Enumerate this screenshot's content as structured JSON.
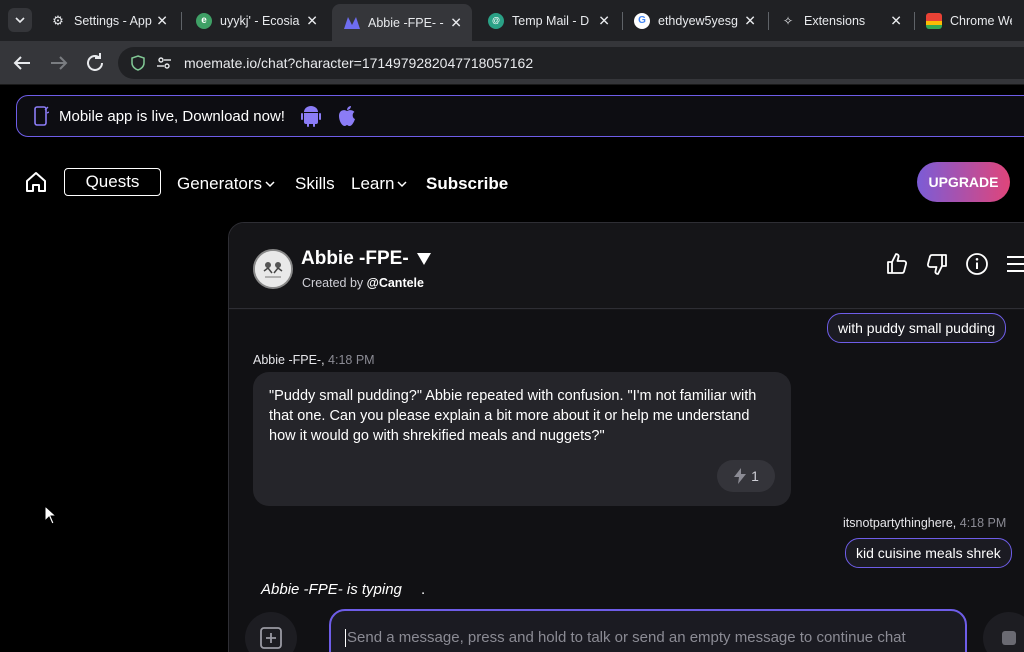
{
  "browser": {
    "tabs": [
      {
        "title": "Settings - App",
        "favicon": "gear-icon",
        "active": false
      },
      {
        "title": "uyykj' - Ecosia",
        "favicon": "ecosia-icon",
        "active": false
      },
      {
        "title": "Abbie -FPE- -",
        "favicon": "moemate-icon",
        "active": true
      },
      {
        "title": "Temp Mail - D",
        "favicon": "tempmail-icon",
        "active": false
      },
      {
        "title": "ethdyew5yesg",
        "favicon": "google-icon",
        "active": false
      },
      {
        "title": "Extensions",
        "favicon": "puzzle-icon",
        "active": false
      },
      {
        "title": "Chrome Web",
        "favicon": "chrome-webstore-icon",
        "active": false
      }
    ],
    "url": "moemate.io/chat?character=1714979282047718057162"
  },
  "banner": {
    "text": "Mobile app is live, Download now!",
    "accent": "#6e5de8"
  },
  "nav": {
    "quests": "Quests",
    "generators": "Generators",
    "skills": "Skills",
    "learn": "Learn",
    "subscribe": "Subscribe",
    "upgrade": "UPGRADE"
  },
  "chat": {
    "character_name": "Abbie -FPE-",
    "created_by_prefix": "Created by",
    "creator": "@Cantele",
    "messages": [
      {
        "role": "user",
        "text": "with puddy small pudding"
      },
      {
        "role": "bot",
        "author": "Abbie -FPE-,",
        "time": "4:18 PM",
        "text": "\"Puddy small pudding?\" Abbie repeated with confusion. \"I'm not familiar with that one. Can you please explain a bit more about it or help me understand how it would go with shrekified meals and nuggets?\"",
        "reaction_count": "1"
      },
      {
        "role": "user",
        "author": "itsnotpartythinghere,",
        "time": "4:18 PM",
        "text": "kid cuisine meals shrek"
      }
    ],
    "typing": "Abbie -FPE- is typing",
    "typing_dot": ".",
    "input_placeholder": "Send a message, press and hold to talk or send an empty message to continue chat"
  }
}
